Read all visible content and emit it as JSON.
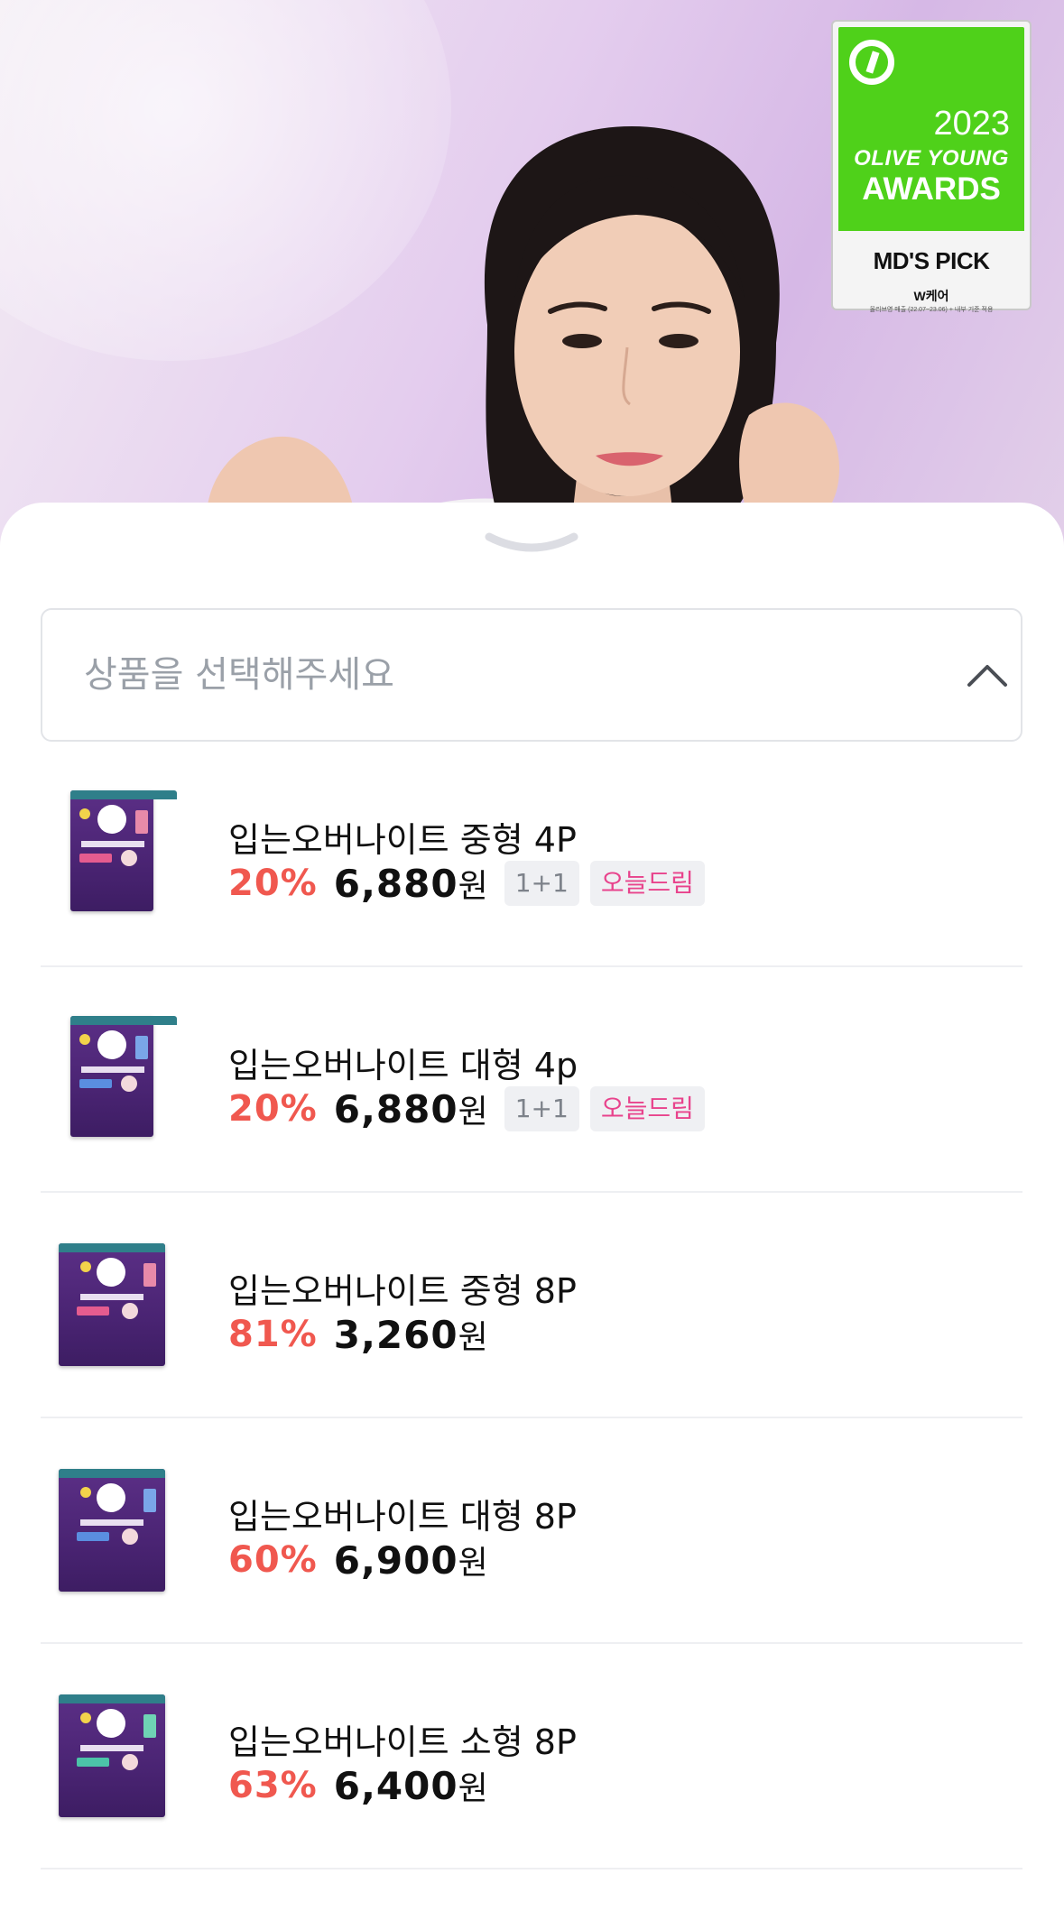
{
  "award": {
    "year": "2023",
    "line1": "OLIVE YOUNG",
    "line2": "AWARDS",
    "pick": "MD'S PICK",
    "brand": "W케어",
    "note": "올리브영 매출 (22.07~23.06) + 내부 기준 적용"
  },
  "selector": {
    "placeholder": "상품을 선택해주세요"
  },
  "colors": {
    "discount": "#f0584f",
    "badge_pink": "#e8438c",
    "package": "#4a2473"
  },
  "products": [
    {
      "name": "입는오버나이트 중형 4P",
      "discount": "20%",
      "price": "6,880",
      "unit": "원",
      "tag1": "1+1",
      "tag2": "오늘드림"
    },
    {
      "name": "입는오버나이트 대형 4p",
      "discount": "20%",
      "price": "6,880",
      "unit": "원",
      "tag1": "1+1",
      "tag2": "오늘드림"
    },
    {
      "name": "입는오버나이트 중형 8P",
      "discount": "81%",
      "price": "3,260",
      "unit": "원"
    },
    {
      "name": "입는오버나이트 대형 8P",
      "discount": "60%",
      "price": "6,900",
      "unit": "원"
    },
    {
      "name": "입는오버나이트 소형 8P",
      "discount": "63%",
      "price": "6,400",
      "unit": "원"
    }
  ]
}
